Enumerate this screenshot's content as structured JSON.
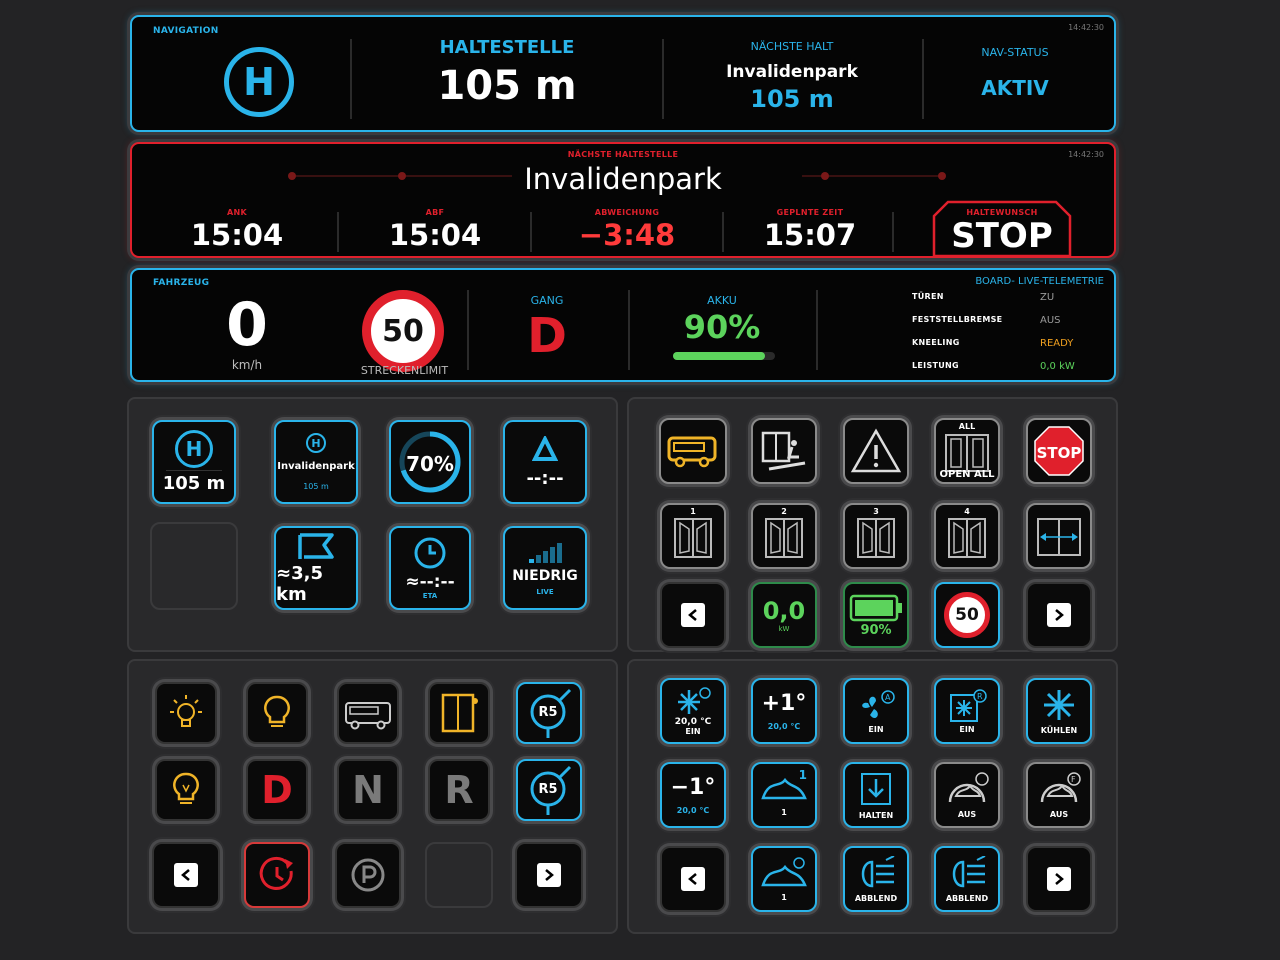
{
  "nav": {
    "section": "NAVIGATION",
    "time": "14:42:30",
    "stop_label": "HALTESTELLE",
    "distance": "105 m",
    "next_label": "NÄCHSTE HALT",
    "next_name": "Invalidenpark",
    "next_distance": "105 m",
    "status_label": "NAV-STATUS",
    "status_value": "AKTIV",
    "icon": "bus-stop-h-icon"
  },
  "stop": {
    "section": "NÄCHSTE HALTESTELLE",
    "time": "14:42:30",
    "name": "Invalidenpark",
    "ank_label": "ANK",
    "ank": "15:04",
    "abf_label": "ABF",
    "abf": "15:04",
    "dev_label": "ABWEICHUNG",
    "dev": "−3:48",
    "plan_label": "GEPLNTE ZEIT",
    "plan": "15:07",
    "req_label": "HALTEWUNSCH",
    "req": "STOP",
    "colors": {
      "deviation": "#ff3b3b",
      "frame": "#e0202c"
    }
  },
  "vehicle": {
    "section": "FAHRZEUG",
    "speed": "0",
    "unit": "km/h",
    "limit": "50",
    "limit_label": "STRECKENLIMIT",
    "gear_label": "GANG",
    "gear": "D",
    "battery_label": "AKKU",
    "battery": "90%",
    "battery_level": 0.9,
    "telemetry_title": "BOARD- LIVE-TELEMETRIE",
    "rows": [
      {
        "label": "TÜREN",
        "value": "ZU",
        "color": "#9a9a9a"
      },
      {
        "label": "FESTSTELLBREMSE",
        "value": "AUS",
        "color": "#9a9a9a"
      },
      {
        "label": "KNEELING",
        "value": "READY",
        "color": "#f0a020"
      },
      {
        "label": "LEISTUNG",
        "value": "0,0 kW",
        "color": "#5cd35c"
      }
    ]
  },
  "left_top": {
    "stop_dist": "105 m",
    "next_name": "Invalidenpark",
    "next_dist": "105 m",
    "progress": "70%",
    "progress_level": 0.7,
    "delta": "--:--",
    "route_dist": "≈3,5 km",
    "eta": "≈--:--",
    "eta_label": "ETA",
    "signal": "NIEDRIG",
    "signal_label": "LIVE"
  },
  "right_top": {
    "open_all_top": "ALL",
    "open_all": "OPEN ALL",
    "stop": "STOP",
    "doors": [
      "1",
      "2",
      "3",
      "4"
    ],
    "power": "0,0",
    "power_unit": "kW",
    "battery": "90%",
    "limit": "50"
  },
  "left_bottom": {
    "gears": [
      "D",
      "N",
      "R"
    ],
    "route": "R5"
  },
  "right_bottom": {
    "row1": [
      {
        "main": "20,0 °C",
        "cap": "EIN"
      },
      {
        "main": "+1°",
        "cap": "20,0 °C"
      },
      {
        "main": "",
        "cap": "EIN"
      },
      {
        "main": "",
        "cap": "EIN"
      },
      {
        "main": "",
        "cap": "KÜHLEN"
      }
    ],
    "row2": [
      {
        "main": "−1°",
        "cap": "20,0 °C"
      },
      {
        "main": "1",
        "cap": "1"
      },
      {
        "main": "",
        "cap": "HALTEN"
      },
      {
        "main": "",
        "cap": "AUS"
      },
      {
        "main": "",
        "cap": "AUS"
      }
    ],
    "row3": [
      {
        "cap": "1"
      },
      {
        "cap": "ABBLEND"
      },
      {
        "cap": "ABBLEND"
      }
    ]
  },
  "colors": {
    "accent": "#2ab4ea",
    "alert": "#e0202c",
    "ok": "#5cd35c",
    "warn": "#f0b428"
  }
}
